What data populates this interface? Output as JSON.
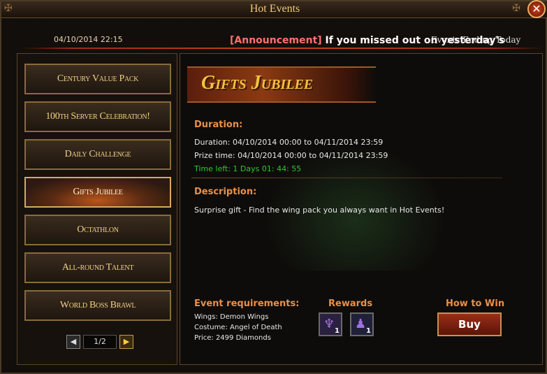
{
  "window": {
    "title": "Hot Events",
    "close_label": "✕"
  },
  "header": {
    "datetime": "04/10/2014 22:15",
    "announcement_tag": "[Announcement]",
    "announcement_text": " If you missed out on yesterday's",
    "ghost_text": "Events Ending Today"
  },
  "sidebar": {
    "items": [
      {
        "label": "Century Value Pack"
      },
      {
        "label": "100th Server Celebration!"
      },
      {
        "label": "Daily Challenge"
      },
      {
        "label": "Gifts Jubilee"
      },
      {
        "label": "Octathlon"
      },
      {
        "label": "All-round Talent"
      },
      {
        "label": "World Boss Brawl"
      }
    ],
    "active_index": 3,
    "pager": {
      "text": "1/2",
      "prev": "◀",
      "next": "▶"
    }
  },
  "event": {
    "title": "Gifts Jubilee",
    "duration_heading": "Duration:",
    "duration": "Duration: 04/10/2014 00:00 to 04/11/2014 23:59",
    "prize_time": "Prize time: 04/10/2014 00:00 to 04/11/2014 23:59",
    "time_left": "Time left: 1 Days  01: 44: 55",
    "description_heading": "Description:",
    "description": "Surprise gift - Find the wing pack you always want in Hot Events!",
    "requirements_heading": "Event requirements:",
    "wings": "Wings: Demon Wings",
    "costume": "Costume: Angel of Death",
    "price": "Price: 2499  Diamonds",
    "rewards_heading": "Rewards",
    "rewards": [
      {
        "icon": "wings-icon",
        "qty": "1"
      },
      {
        "icon": "costume-icon",
        "qty": "1"
      }
    ],
    "how_to_win_heading": "How to Win",
    "buy_label": "Buy"
  },
  "colors": {
    "accent": "#e8904a",
    "title_gold": "#f4c040",
    "time_green": "#2ec82e",
    "announce_red": "#ff7070"
  }
}
